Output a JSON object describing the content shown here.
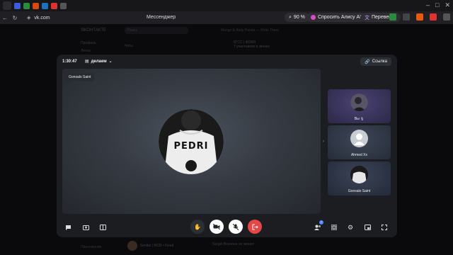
{
  "browser": {
    "address": "vk.com",
    "page_title": "Мессенджер",
    "zoom": "90 %",
    "alice_button": "Спросить Алису AI",
    "translate_button": "Перевести"
  },
  "background_page": {
    "logo": "ВКОНТАКТЕ",
    "search_placeholder": "Поиск",
    "menu": [
      "Профиль",
      "Лента"
    ],
    "chats_heading": "Чаты",
    "dialog_title": "КГСС | ФОКИ",
    "dialog_subtitle": "7 участников в звонке",
    "player_text": "Mungo & Andy Panda — Write There",
    "bottom_item": "Senitor | RCB • Fixed",
    "bottom_left": "Приложения",
    "bottom_msg": "Sergei Bosnova не звонит"
  },
  "call": {
    "timer": "1:30:47",
    "title": "делаем",
    "link_label": "Ссылка",
    "main_participant": "Gonsalo Saint",
    "jersey_text": "PEDRI",
    "participants": [
      {
        "name": "Вы",
        "suffix": "🎙",
        "avatar": "photo-dark"
      },
      {
        "name": "Ahmed Xx",
        "suffix": "",
        "avatar": "placeholder"
      },
      {
        "name": "Gonsalo Saint",
        "suffix": "",
        "avatar": "photo-jersey"
      }
    ],
    "participants_badge": "7",
    "colors": {
      "end_call": "#e64646",
      "accent": "#4a8cff",
      "tile_you": "#3a3560",
      "tile_ahmed": "#2f3645",
      "tile_gonsalo": "#2a3142"
    }
  }
}
